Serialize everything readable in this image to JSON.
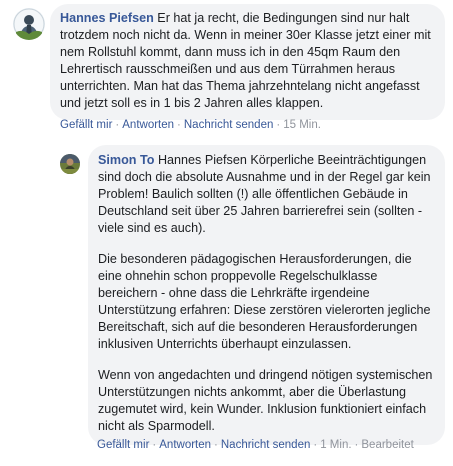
{
  "comments": [
    {
      "author": "Hannes Piefsen",
      "text": "Er hat ja recht, die Bedingungen sind nur halt trotzdem noch nicht da. Wenn in meiner 30er Klasse jetzt einer mit nem Rollstuhl kommt, dann muss ich in den 45qm Raum den Lehrertisch rausschmeißen und aus dem Türrahmen heraus unterrichten. Man hat das Thema jahrzehntelang nicht angefasst und jetzt soll es in 1 bis 2 Jahren alles klappen.",
      "actions": {
        "like": "Gefällt mir",
        "reply": "Antworten",
        "message": "Nachricht senden",
        "time": "15 Min."
      },
      "separator": "·"
    },
    {
      "author": "Simon To",
      "mention": "Hannes Piefsen",
      "paragraphs": [
        "Körperliche Beeinträchtigungen sind doch die absolute Ausnahme und in der Regel gar kein Problem! Baulich sollten (!) alle öffentlichen Gebäude in Deutschland seit über 25 Jahren barrierefrei sein (sollten - viele sind es auch).",
        "Die besonderen pädagogischen Herausforderungen, die eine ohnehin schon proppevolle Regelschulklasse bereichern - ohne dass die Lehrkräfte irgendeine Unterstützung erfahren: Diese zerstören vielerorten jegliche Bereitschaft, sich auf die besonderen Herausforderungen inklusiven Unterrichts überhaupt einzulassen.",
        "Wenn von angedachten und dringend nötigen systemischen Unterstützungen nichts ankommt, aber die Überlastung zugemutet wird, kein Wunder. Inklusion funktioniert einfach nicht als Sparmodell."
      ],
      "actions": {
        "like": "Gefällt mir",
        "reply": "Antworten",
        "message": "Nachricht senden",
        "time": "1 Min.",
        "edited": "Bearbeitet"
      },
      "separator": "·"
    }
  ]
}
